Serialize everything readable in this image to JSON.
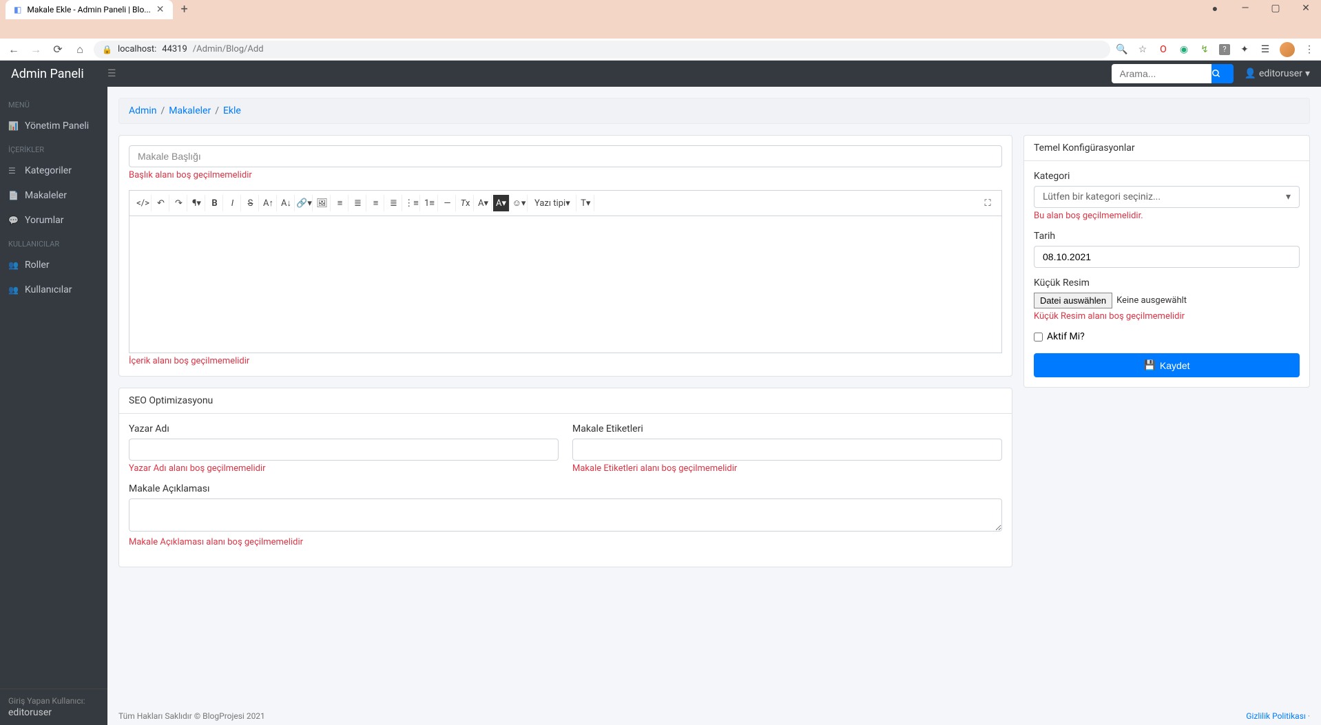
{
  "browser": {
    "tab_title": "Makale Ekle - Admin Paneli | Blo...",
    "url_host": "localhost:",
    "url_port": "44319",
    "url_path": "/Admin/Blog/Add"
  },
  "topnav": {
    "brand": "Admin Paneli",
    "search_placeholder": "Arama...",
    "user": "editoruser"
  },
  "sidebar": {
    "headers": {
      "menu": "MENÜ",
      "contents": "İÇERİKLER",
      "users": "KULLANICILAR"
    },
    "items": {
      "dashboard": "Yönetim Paneli",
      "categories": "Kategoriler",
      "articles": "Makaleler",
      "comments": "Yorumlar",
      "roles": "Roller",
      "users": "Kullanıcılar"
    },
    "footer_label": "Giriş Yapan Kullanıcı:",
    "footer_user": "editoruser"
  },
  "breadcrumb": {
    "admin": "Admin",
    "articles": "Makaleler",
    "add": "Ekle"
  },
  "form": {
    "title_placeholder": "Makale Başlığı",
    "title_error": "Başlık alanı boş geçilmemelidir",
    "content_error": "İçerik alanı boş geçilmemelidir",
    "font_label": "Yazı tipi"
  },
  "seo": {
    "header": "SEO Optimizasyonu",
    "author_label": "Yazar Adı",
    "author_error": "Yazar Adı alanı boş geçilmemelidir",
    "tags_label": "Makale Etiketleri",
    "tags_error": "Makale Etiketleri alanı boş geçilmemelidir",
    "desc_label": "Makale Açıklaması",
    "desc_error": "Makale Açıklaması alanı boş geçilmemelidir"
  },
  "config": {
    "header": "Temel Konfigürasyonlar",
    "category_label": "Kategori",
    "category_placeholder": "Lütfen bir kategori seçiniz...",
    "category_error": "Bu alan boş geçilmemelidir.",
    "date_label": "Tarih",
    "date_value": "08.10.2021",
    "thumb_label": "Küçük Resim",
    "file_button": "Datei auswählen",
    "file_status": "Keine ausgewählt",
    "thumb_error": "Küçük Resim alanı boş geçilmemelidir",
    "active_label": "Aktif Mi?",
    "save_label": "Kaydet"
  },
  "footer": {
    "copyright": "Tüm Hakları Saklıdır © BlogProjesi 2021",
    "privacy": "Gizlilik Politikası"
  }
}
